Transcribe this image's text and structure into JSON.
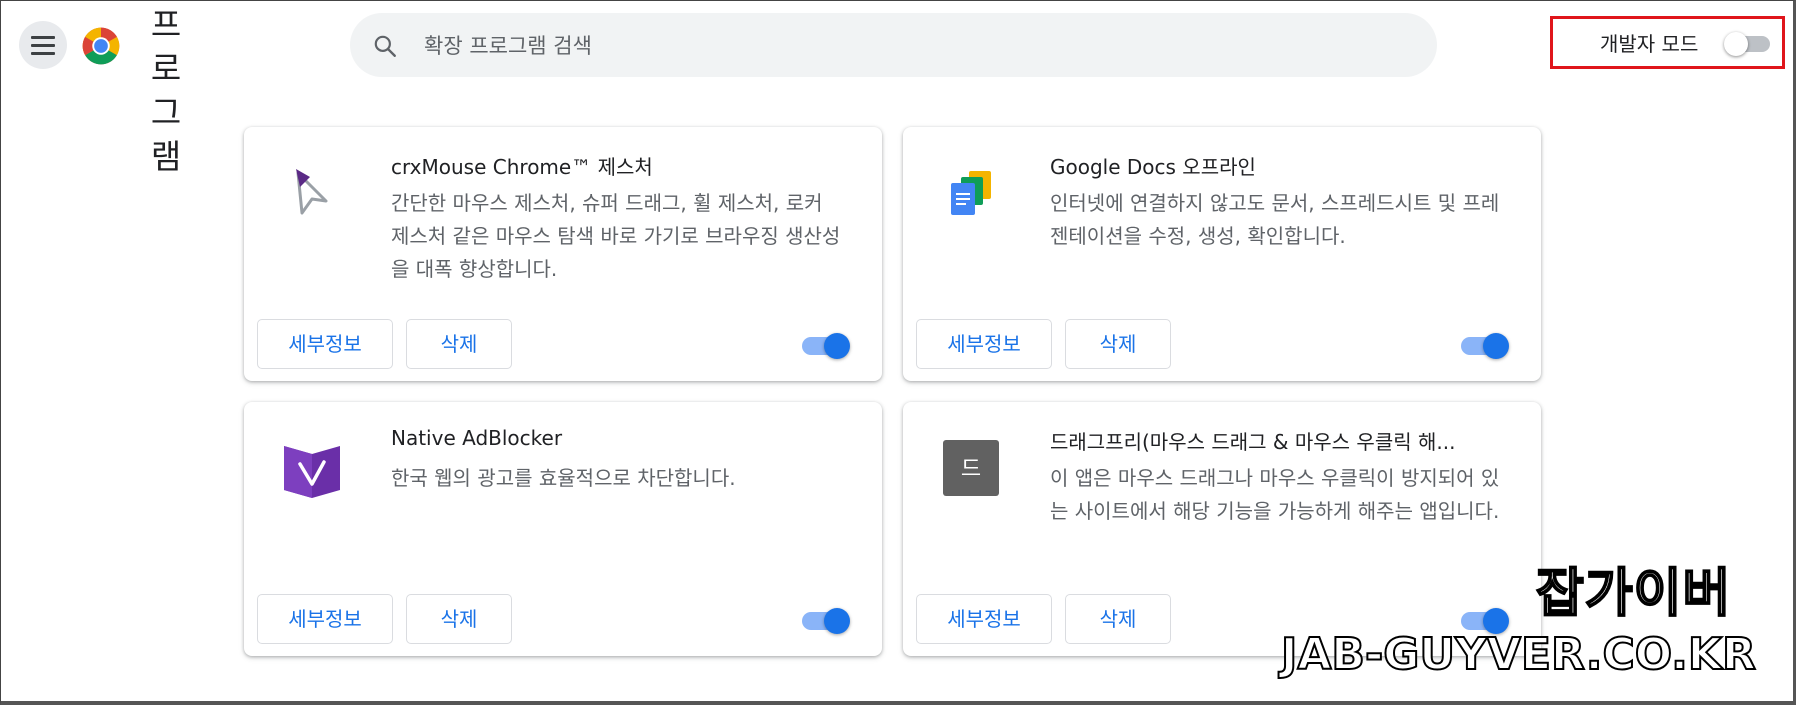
{
  "header": {
    "title": "프로그램",
    "title_chars": [
      "프",
      "로",
      "그",
      "램"
    ],
    "menu_icon": "hamburger-menu-icon",
    "logo_icon": "chrome-logo-icon"
  },
  "search": {
    "placeholder": "확장 프로그램 검색",
    "icon": "search-icon"
  },
  "developer_mode": {
    "label": "개발자 모드",
    "enabled": false
  },
  "extensions": [
    {
      "name": "crxMouse Chrome™ 제스처",
      "description": "간단한 마우스 제스처, 슈퍼 드래그, 휠 제스처, 로커 제스처 같은 마우스 탐색 바로 가기로 브라우징 생산성을 대폭 향상합니다.",
      "icon": "mouse-pointer-icon",
      "details_label": "세부정보",
      "remove_label": "삭제",
      "enabled": true
    },
    {
      "name": "Google Docs 오프라인",
      "description": "인터넷에 연결하지 않고도 문서, 스프레드시트 및 프레젠테이션을 수정, 생성, 확인합니다.",
      "icon": "google-docs-icon",
      "details_label": "세부정보",
      "remove_label": "삭제",
      "enabled": true
    },
    {
      "name": "Native AdBlocker",
      "description": "한국 웹의 광고를 효율적으로 차단합니다.",
      "icon": "adblocker-shield-icon",
      "details_label": "세부정보",
      "remove_label": "삭제",
      "enabled": true
    },
    {
      "name": "드래그프리(마우스 드래그 & 마우스 우클릭 해...",
      "description": "이 앱은 마우스 드래그나 마우스 우클릭이 방지되어 있는 사이트에서 해당 기능을 가능하게 해주는 앱입니다.",
      "icon": "dragfree-app-icon",
      "icon_text": "드",
      "details_label": "세부정보",
      "remove_label": "삭제",
      "enabled": true
    }
  ],
  "watermark": {
    "line1": "잡가이버",
    "line2": "JAB-GUYVER.CO.KR"
  },
  "colors": {
    "accent": "#1a73e8",
    "toggle_track_on": "#8ab4f8",
    "highlight_border": "#e0151b",
    "search_bg": "#f1f3f4"
  }
}
